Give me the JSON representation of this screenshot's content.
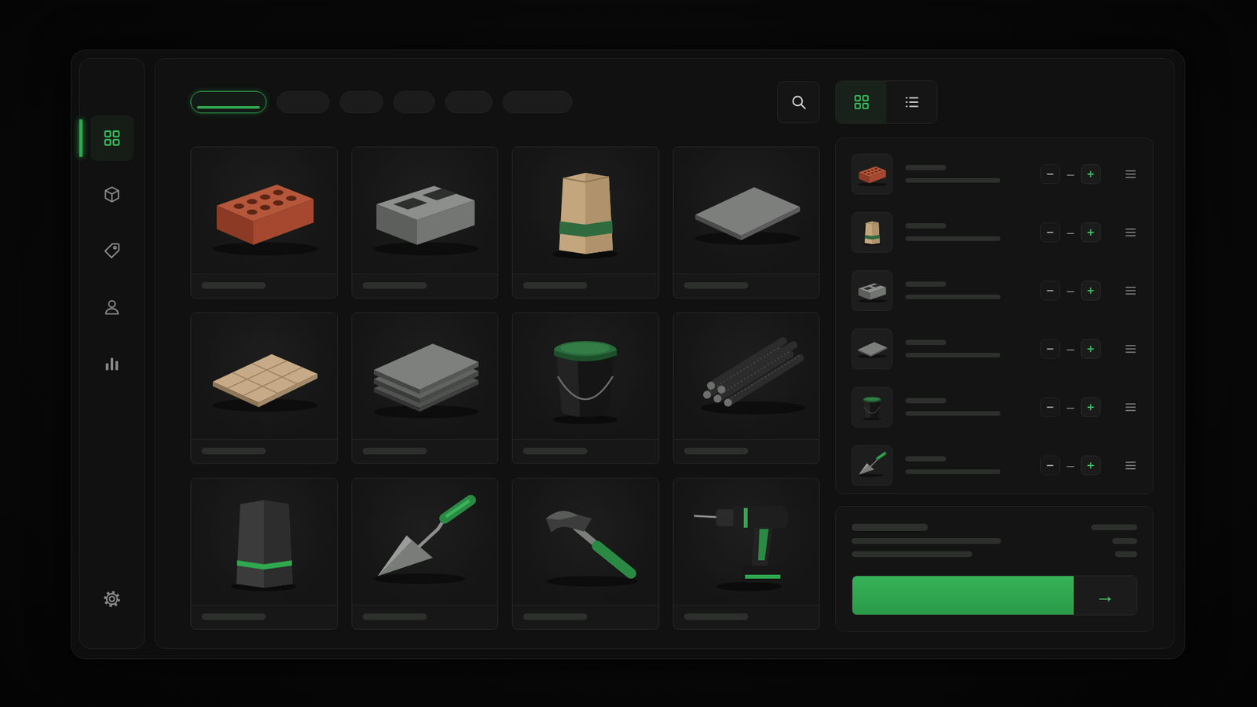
{
  "sidebar": {
    "items": [
      {
        "kind": "grid",
        "selected": true
      },
      {
        "kind": "cube",
        "selected": false
      },
      {
        "kind": "tag",
        "selected": false
      },
      {
        "kind": "user",
        "selected": false
      },
      {
        "kind": "chart",
        "selected": false
      }
    ],
    "footer": {
      "kind": "settings",
      "selected": false
    }
  },
  "tabs": [
    {
      "selected": true
    },
    {
      "selected": false
    },
    {
      "selected": false
    },
    {
      "selected": false
    },
    {
      "selected": false
    },
    {
      "selected": false
    }
  ],
  "view_toggle": [
    {
      "kind": "grid",
      "selected": true
    },
    {
      "kind": "list",
      "selected": false
    }
  ],
  "products": [
    {
      "kind": "brick"
    },
    {
      "kind": "block"
    },
    {
      "kind": "bag"
    },
    {
      "kind": "tile"
    },
    {
      "kind": "tiles"
    },
    {
      "kind": "slabs"
    },
    {
      "kind": "bucket"
    },
    {
      "kind": "rebar"
    },
    {
      "kind": "bag-dark"
    },
    {
      "kind": "trowel"
    },
    {
      "kind": "hammer"
    },
    {
      "kind": "drill"
    }
  ],
  "cart": [
    {
      "kind": "brick",
      "qty": "–"
    },
    {
      "kind": "bag",
      "qty": "–"
    },
    {
      "kind": "block",
      "qty": "–"
    },
    {
      "kind": "tile",
      "qty": "–"
    },
    {
      "kind": "bucket",
      "qty": "–"
    },
    {
      "kind": "trowel",
      "qty": "–"
    }
  ],
  "checkout": {
    "arrow": "→"
  }
}
